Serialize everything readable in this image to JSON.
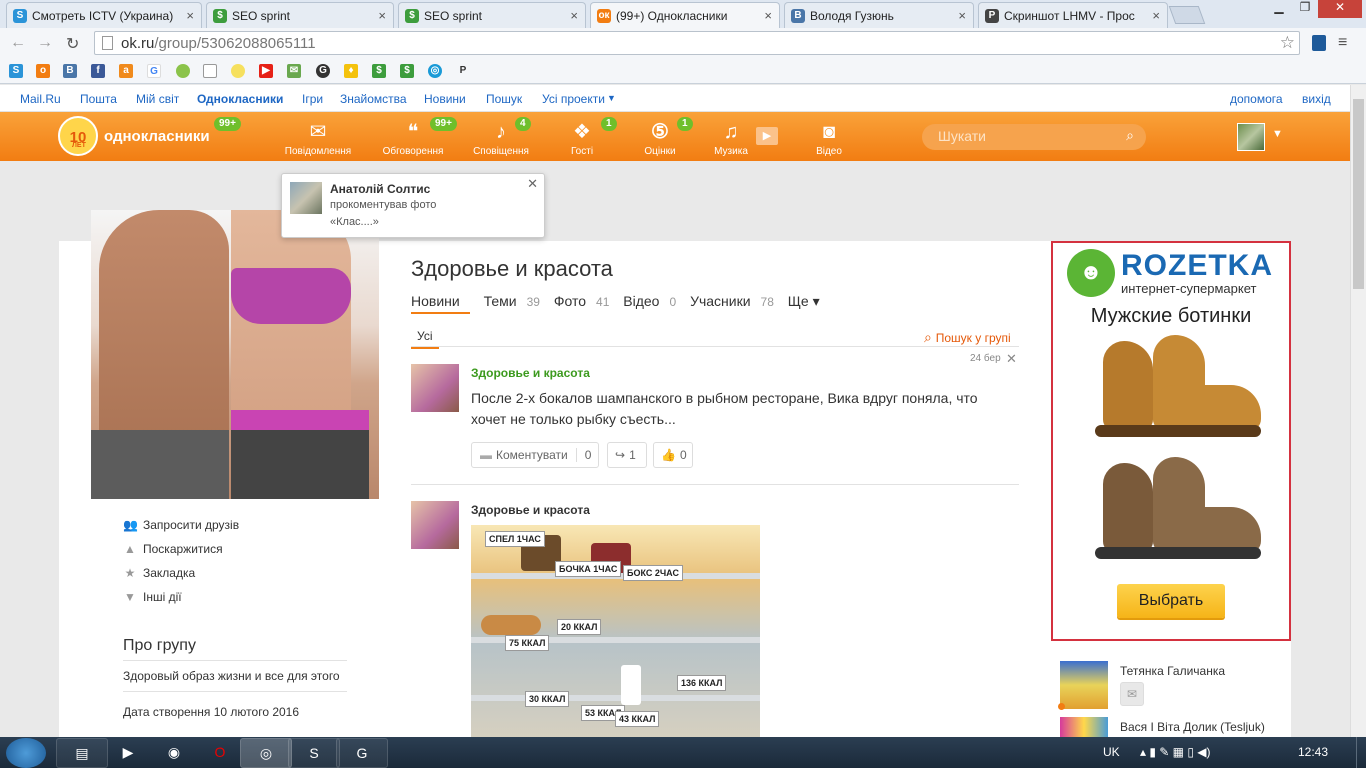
{
  "browser": {
    "tabs": [
      {
        "title": "Смотреть ICTV (Украина)",
        "icon": "skype-blue-icon",
        "color": "#2b94d8",
        "glyph": "S"
      },
      {
        "title": "SEO sprint",
        "icon": "seosprint-icon",
        "color": "#3d9d3d",
        "glyph": "$"
      },
      {
        "title": "SEO sprint",
        "icon": "seosprint-icon",
        "color": "#3d9d3d",
        "glyph": "$"
      },
      {
        "title": "(99+) Однокласники",
        "icon": "ok-icon",
        "color": "#f27d12",
        "glyph": "ок"
      },
      {
        "title": "Володя Гузюнь",
        "icon": "vk-icon",
        "color": "#4a76a8",
        "glyph": "B"
      },
      {
        "title": "Скриншот LHMV - Прос",
        "icon": "p-icon",
        "color": "#444444",
        "glyph": "P"
      }
    ],
    "url_host": "ok.ru",
    "url_path": "/group/53062088065111"
  },
  "portal_links": [
    "Mail.Ru",
    "Пошта",
    "Мій світ",
    "Однокласники",
    "Ігри",
    "Знайомства",
    "Новини",
    "Пошук",
    "Усі проекти"
  ],
  "portal_right": [
    "допомога",
    "вихід"
  ],
  "ok": {
    "logo_badge": "10",
    "logo_badge_sub": "ЛЕТ",
    "logo_text": "однокласники",
    "logo_count": "99+",
    "nav": [
      {
        "label": "Повідомлення",
        "icon": "envelope-icon",
        "glyph": "✉",
        "badge": ""
      },
      {
        "label": "Обговорення",
        "icon": "chat-bubbles-icon",
        "glyph": "💬",
        "badge": "99+"
      },
      {
        "label": "Сповіщення",
        "icon": "bell-icon",
        "glyph": "🔔",
        "badge": "4"
      },
      {
        "label": "Гості",
        "icon": "footprints-icon",
        "glyph": "👣",
        "badge": "1"
      },
      {
        "label": "Оцінки",
        "icon": "rating-5-icon",
        "glyph": "5",
        "badge": "1"
      },
      {
        "label": "Музика",
        "icon": "music-note-icon",
        "glyph": "♫",
        "badge": ""
      },
      {
        "label": "Відео",
        "icon": "video-camera-icon",
        "glyph": "🎥",
        "badge": ""
      }
    ],
    "search_placeholder": "Шукати"
  },
  "popup": {
    "name": "Анатолій Солтис",
    "text1": "прокоментував фото",
    "text2": "«Клас....»"
  },
  "group": {
    "title": "Здоровье и красота",
    "tabs": [
      {
        "label": "Новини",
        "count": ""
      },
      {
        "label": "Теми",
        "count": "39"
      },
      {
        "label": "Фото",
        "count": "41"
      },
      {
        "label": "Відео",
        "count": "0"
      },
      {
        "label": "Учасники",
        "count": "78"
      },
      {
        "label": "Ще ▾",
        "count": ""
      }
    ],
    "filter_all": "Усі",
    "search_in_group": "Пошук у групі",
    "side_actions": [
      "Запросити друзів",
      "Поскаржитися",
      "Закладка",
      "Інші дії"
    ],
    "about_title": "Про групу",
    "about_text": "Здоровый образ жизни и все для этого",
    "created": "Дата створення 10 лютого 2016"
  },
  "posts": [
    {
      "author": "Здоровье и красота",
      "date": "24 бер",
      "text": "После 2-х бокалов шампанского в рыбном ресторане, Вика вдруг поняла, что хочет не только рыбку съесть...",
      "comment_label": "Коментувати",
      "comments": "0",
      "shares": "1",
      "likes": "0"
    },
    {
      "author": "Здоровье и красота",
      "photo_labels": [
        "СПЕЛ 1ЧАС",
        "БОЧКА 1ЧАС",
        "БОКС 2ЧАС",
        "20 ККАЛ",
        "75 ККАЛ",
        "136 ККАЛ",
        "30 ККАЛ",
        "53 ККАЛ",
        "43 ККАЛ"
      ]
    }
  ],
  "ad": {
    "brand": "ROZETKA",
    "subtitle": "интернет-супермаркет",
    "headline": "Мужские ботинки",
    "button": "Выбрать"
  },
  "friends": [
    "Тетянка Галичанка",
    "Вася І Віта Долик (Tesljuk)"
  ],
  "tray": {
    "lang": "UK",
    "time": "12:43"
  }
}
